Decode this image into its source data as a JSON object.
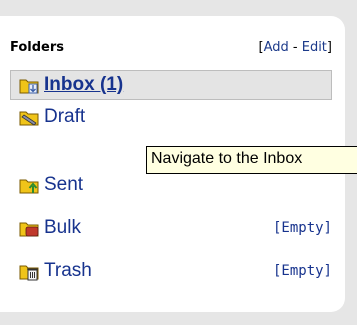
{
  "folders": {
    "title": "Folders",
    "actions": {
      "open": "[",
      "add": "Add",
      "sep": " - ",
      "edit": "Edit",
      "close": "]"
    },
    "items": [
      {
        "label": "Inbox (1)",
        "icon": "inbox-folder-icon",
        "empty": ""
      },
      {
        "label": "Draft",
        "icon": "draft-folder-icon",
        "empty": ""
      },
      {
        "label": "Sent",
        "icon": "sent-folder-icon",
        "empty": ""
      },
      {
        "label": "Bulk",
        "icon": "bulk-folder-icon",
        "empty": "[Empty]"
      },
      {
        "label": "Trash",
        "icon": "trash-folder-icon",
        "empty": "[Empty]"
      }
    ]
  },
  "tooltip": {
    "text": "Navigate to the Inbox"
  },
  "colors": {
    "link": "#17338e",
    "selected_bg": "#e4e4e4",
    "tooltip_bg": "#ffffe1",
    "folder": "#f0c419"
  }
}
